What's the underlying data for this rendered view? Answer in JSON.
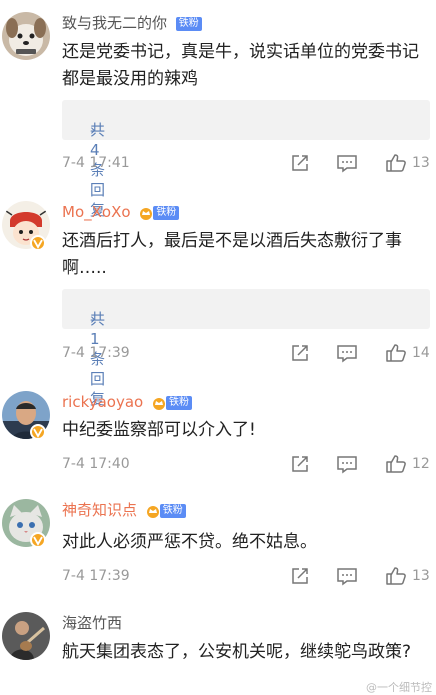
{
  "comments": [
    {
      "username": "致与我无二的你",
      "badge": "铁粉",
      "has_crown": false,
      "text": "还是党委书记，真是牛，说实话单位的党委书记都是最没用的辣鸡",
      "replies_label": "共4条回复",
      "time": "7-4 17:41",
      "likes": "13",
      "avatar_icon": "dog-avatar",
      "vip": false
    },
    {
      "username": "Mo_XoXo",
      "badge": "铁粉",
      "has_crown": true,
      "text": "还酒后打人，最后是不是以酒后失态敷衍了事啊…..",
      "replies_label": "共1条回复",
      "time": "7-4 17:39",
      "likes": "14",
      "avatar_icon": "cartoon-avatar",
      "vip": true
    },
    {
      "username": "rickyaoyao",
      "badge": "铁粉",
      "has_crown": true,
      "text": "中纪委监察部可以介入了!",
      "replies_label": "",
      "time": "7-4 17:40",
      "likes": "12",
      "avatar_icon": "man-avatar",
      "vip": true
    },
    {
      "username": "神奇知识点",
      "badge": "铁粉",
      "has_crown": true,
      "text": "对此人必须严惩不贷。绝不姑息。",
      "replies_label": "",
      "time": "7-4 17:39",
      "likes": "13",
      "avatar_icon": "cat-avatar",
      "vip": true
    },
    {
      "username": "海盗竹西",
      "badge": "",
      "has_crown": false,
      "text": "航天集团表态了，公安机关呢，继续鸵鸟政策?",
      "replies_label": "",
      "time": "",
      "likes": "",
      "avatar_icon": "guitar-avatar",
      "vip": false
    }
  ],
  "watermark": "@一个细节控",
  "colors": {
    "username_orange": "#eb7350",
    "username_gray": "#555555",
    "link_blue": "#5b7fb7",
    "tag_blue": "#5b8cf5",
    "vip_gold": "#f5a623"
  }
}
